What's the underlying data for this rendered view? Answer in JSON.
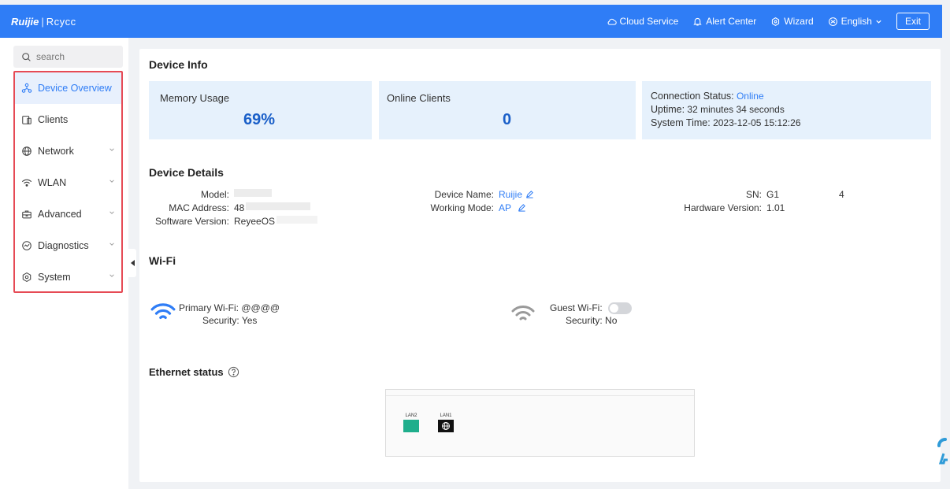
{
  "header": {
    "brand": "Ruijie",
    "separator": "|",
    "product": "Rcycc",
    "nav": {
      "cloud": "Cloud Service",
      "alert": "Alert Center",
      "wizard": "Wizard",
      "language": "English",
      "exit": "Exit"
    }
  },
  "sidebar": {
    "search_placeholder": "search",
    "items": [
      {
        "label": "Device Overview"
      },
      {
        "label": "Clients"
      },
      {
        "label": "Network"
      },
      {
        "label": "WLAN"
      },
      {
        "label": "Advanced"
      },
      {
        "label": "Diagnostics"
      },
      {
        "label": "System"
      }
    ]
  },
  "device_info": {
    "title": "Device Info",
    "memory_label": "Memory Usage",
    "memory_value": "69%",
    "clients_label": "Online Clients",
    "clients_value": "0",
    "conn_status_label": "Connection Status:",
    "conn_status_value": "Online",
    "uptime_label": "Uptime:",
    "uptime_value": "32 minutes 34 seconds",
    "systime_label": "System Time:",
    "systime_value": "2023-12-05 15:12:26"
  },
  "device_details": {
    "title": "Device Details",
    "model_label": "Model:",
    "mac_label": "MAC Address:",
    "mac_value": "48",
    "sw_label": "Software Version:",
    "sw_value": "ReyeeOS",
    "name_label": "Device Name:",
    "name_value": "Ruijie",
    "mode_label": "Working Mode:",
    "mode_value": "AP",
    "sn_label": "SN:",
    "sn_value_start": "G1",
    "sn_value_end": "4",
    "hw_label": "Hardware Version:",
    "hw_value": "1.01"
  },
  "wifi": {
    "title": "Wi-Fi",
    "primary_label": "Primary Wi-Fi:",
    "primary_value": "@@@@",
    "primary_security_label": "Security:",
    "primary_security_value": "Yes",
    "guest_label": "Guest Wi-Fi:",
    "guest_security_label": "Security:",
    "guest_security_value": "No"
  },
  "ethernet": {
    "title": "Ethernet status",
    "ports": [
      {
        "label": "LAN2",
        "color": "#1fae8c"
      },
      {
        "label": "LAN1",
        "color": "#111111"
      }
    ]
  },
  "colors": {
    "accent": "#2f7df6",
    "highlight_border": "#e64a55"
  }
}
